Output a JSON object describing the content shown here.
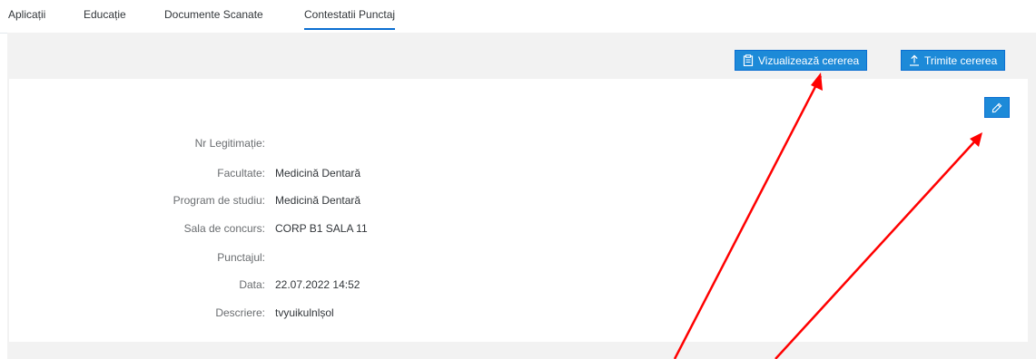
{
  "tabs": [
    {
      "label": "Aplicații"
    },
    {
      "label": "Educație"
    },
    {
      "label": "Documente Scanate"
    },
    {
      "label": "Contestatii Punctaj"
    }
  ],
  "toolbar": {
    "view_label": "Vizualizează cererea",
    "send_label": "Trimite cererea"
  },
  "details": [
    {
      "label": "Nr Legitimație:",
      "value": ""
    },
    {
      "label": "Facultate:",
      "value": "Medicină Dentară"
    },
    {
      "label": "Program de studiu:",
      "value": "Medicină Dentară"
    },
    {
      "label": "Sala de concurs:",
      "value": "CORP B1 SALA 11"
    },
    {
      "label": "Punctajul:",
      "value": ""
    },
    {
      "label": "Data:",
      "value": "22.07.2022 14:52"
    },
    {
      "label": "Descriere:",
      "value": "tvyuikulnlșol"
    }
  ],
  "colors": {
    "accent": "#0a6ed1",
    "button_bg": "#1d8ad8",
    "annotation_arrow": "#ff0000"
  },
  "icons": {
    "view": "clipboard-icon",
    "send": "upload-icon",
    "edit": "pencil-icon"
  }
}
